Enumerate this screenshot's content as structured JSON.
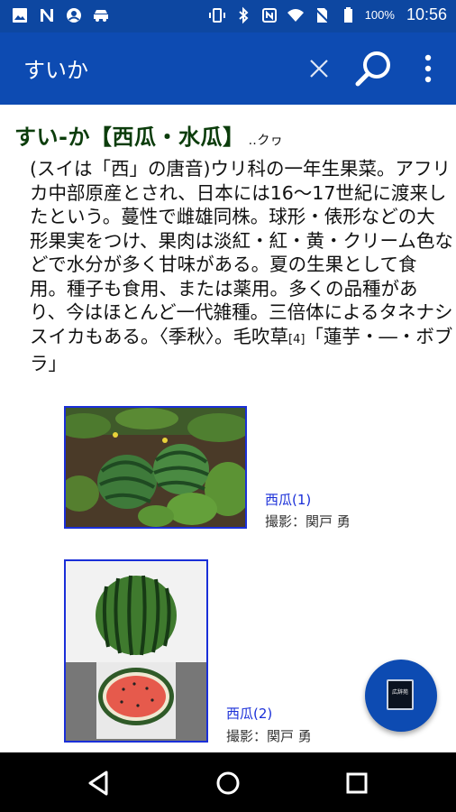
{
  "status_bar": {
    "battery": "100%",
    "time": "10:56",
    "left_icons": [
      "gallery-icon",
      "n-app-icon",
      "account-icon",
      "car-icon"
    ],
    "right_icons": [
      "vibrate-icon",
      "bluetooth-icon",
      "nfc-icon",
      "wifi-icon",
      "no-sim-icon",
      "battery-icon"
    ]
  },
  "app_bar": {
    "query": "すいか",
    "clear_icon": "close-icon",
    "search_icon": "search-icon",
    "more_icon": "more-vert-icon",
    "color": "#0d4bb2"
  },
  "entry": {
    "headword": "すい‐か【西瓜・水瓜】",
    "reading": "‥クヮ",
    "definition_main": "(スイは「西」の唐音)ウリ科の一年生果菜。アフリカ中部原産とされ、日本には16～17世紀に渡来したという。蔓性で雌雄同株。球形・俵形などの大形果実をつけ、果肉は淡紅・紅・黄・クリーム色などで水分が多く甘味がある。夏の生果として食用。種子も食用、または薬用。多くの品種があり、今はほとんど一代雑種。三倍体によるタネナシスイカもある。〈季秋〉。毛吹草",
    "definition_sub": "[4]",
    "definition_end": "「蓮芋・―・ボブラ」"
  },
  "figures": [
    {
      "label": "西瓜(1)",
      "credit": "撮影：関戸 勇"
    },
    {
      "label": "西瓜(2)",
      "credit": "撮影：関戸 勇"
    }
  ],
  "fab": {
    "icon": "dictionary-book-icon",
    "text": "広辞苑"
  },
  "nav_bar": {
    "back": "back-icon",
    "home": "home-icon",
    "recents": "recents-icon"
  }
}
